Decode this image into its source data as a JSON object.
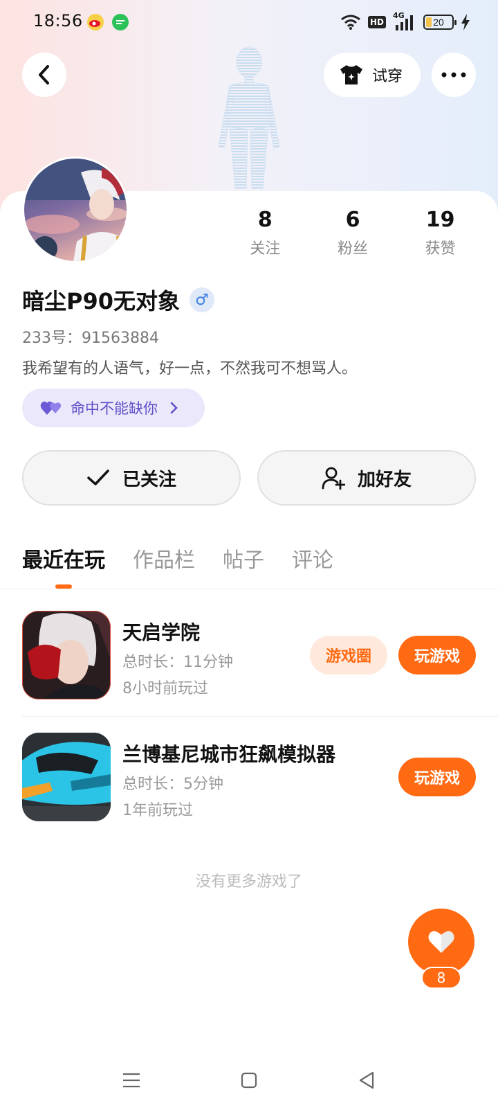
{
  "status_bar": {
    "time": "18:56",
    "network": "4G",
    "hd": "HD",
    "battery": "20"
  },
  "header": {
    "try_on_label": "试穿"
  },
  "profile": {
    "stats": [
      {
        "value": "8",
        "label": "关注"
      },
      {
        "value": "6",
        "label": "粉丝"
      },
      {
        "value": "19",
        "label": "获赞"
      }
    ],
    "username": "暗尘P90无对象",
    "gender_symbol": "♂",
    "user_id": "233号：91563884",
    "bio": "我希望有的人语气，好一点，不然我可不想骂人。",
    "tag_label": "命中不能缺你"
  },
  "actions": {
    "followed_label": "已关注",
    "add_friend_label": "加好友"
  },
  "tabs": [
    {
      "label": "最近在玩",
      "active": true
    },
    {
      "label": "作品栏",
      "active": false
    },
    {
      "label": "帖子",
      "active": false
    },
    {
      "label": "评论",
      "active": false
    }
  ],
  "games": [
    {
      "title": "天启学院",
      "duration": "总时长：11分钟",
      "last_played": "8小时前玩过",
      "circle_label": "游戏圈",
      "play_label": "玩游戏"
    },
    {
      "title": "兰博基尼城市狂飙模拟器",
      "duration": "总时长：5分钟",
      "last_played": "1年前玩过",
      "play_label": "玩游戏"
    }
  ],
  "no_more_text": "没有更多游戏了",
  "like": {
    "count": "8"
  },
  "colors": {
    "accent": "#ff6a13",
    "tag_bg": "#ece8fb",
    "tag_text": "#5b4fc7"
  }
}
